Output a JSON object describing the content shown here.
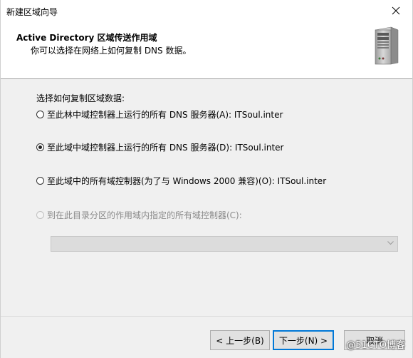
{
  "window": {
    "title": "新建区域向导"
  },
  "header": {
    "title": "Active Directory 区域传送作用域",
    "subtitle": "你可以选择在网络上如何复制 DNS 数据。"
  },
  "content": {
    "prompt": "选择如何复制区域数据:",
    "options": [
      {
        "label": "至此林中域控制器上运行的所有 DNS 服务器(A): ITSoul.inter",
        "checked": false,
        "disabled": false
      },
      {
        "label": "至此域中域控制器上运行的所有 DNS 服务器(D): ITSoul.inter",
        "checked": true,
        "disabled": false
      },
      {
        "label": "至此域中的所有域控制器(为了与 Windows 2000 兼容)(O): ITSoul.inter",
        "checked": false,
        "disabled": false
      },
      {
        "label": "到在此目录分区的作用域内指定的所有域控制器(C):",
        "checked": false,
        "disabled": true
      }
    ],
    "combo_value": ""
  },
  "footer": {
    "back_label": "< 上一步(B)",
    "next_label": "下一步(N) >",
    "cancel_label": "取消"
  },
  "watermark": "@51CTO博客",
  "colors": {
    "accent": "#0078d7",
    "panel": "#f0f0f0",
    "header_bg": "#ffffff"
  },
  "icons": {
    "close": "close-icon",
    "server": "server-icon",
    "dropdown": "chevron-down-icon"
  }
}
